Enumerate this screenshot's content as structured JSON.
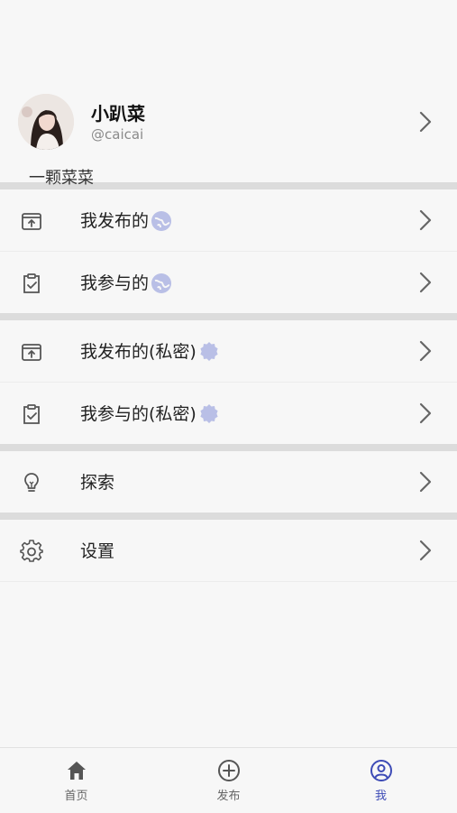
{
  "profile": {
    "name": "小趴菜",
    "handle": "@caicai",
    "bio": "一颗菜菜"
  },
  "menu": {
    "my_published": "我发布的",
    "my_joined": "我参与的",
    "my_published_private": "我发布的(私密)",
    "my_joined_private": "我参与的(私密)",
    "explore": "探索",
    "settings": "设置"
  },
  "tabs": [
    {
      "label": "首页",
      "icon": "home-icon"
    },
    {
      "label": "发布",
      "icon": "plus-circle-icon"
    },
    {
      "label": "我",
      "icon": "user-circle-icon",
      "active": true
    }
  ],
  "colors": {
    "accent": "#3d4bb6",
    "badge": "#b9bfe6",
    "divider": "#dcdcdc"
  }
}
